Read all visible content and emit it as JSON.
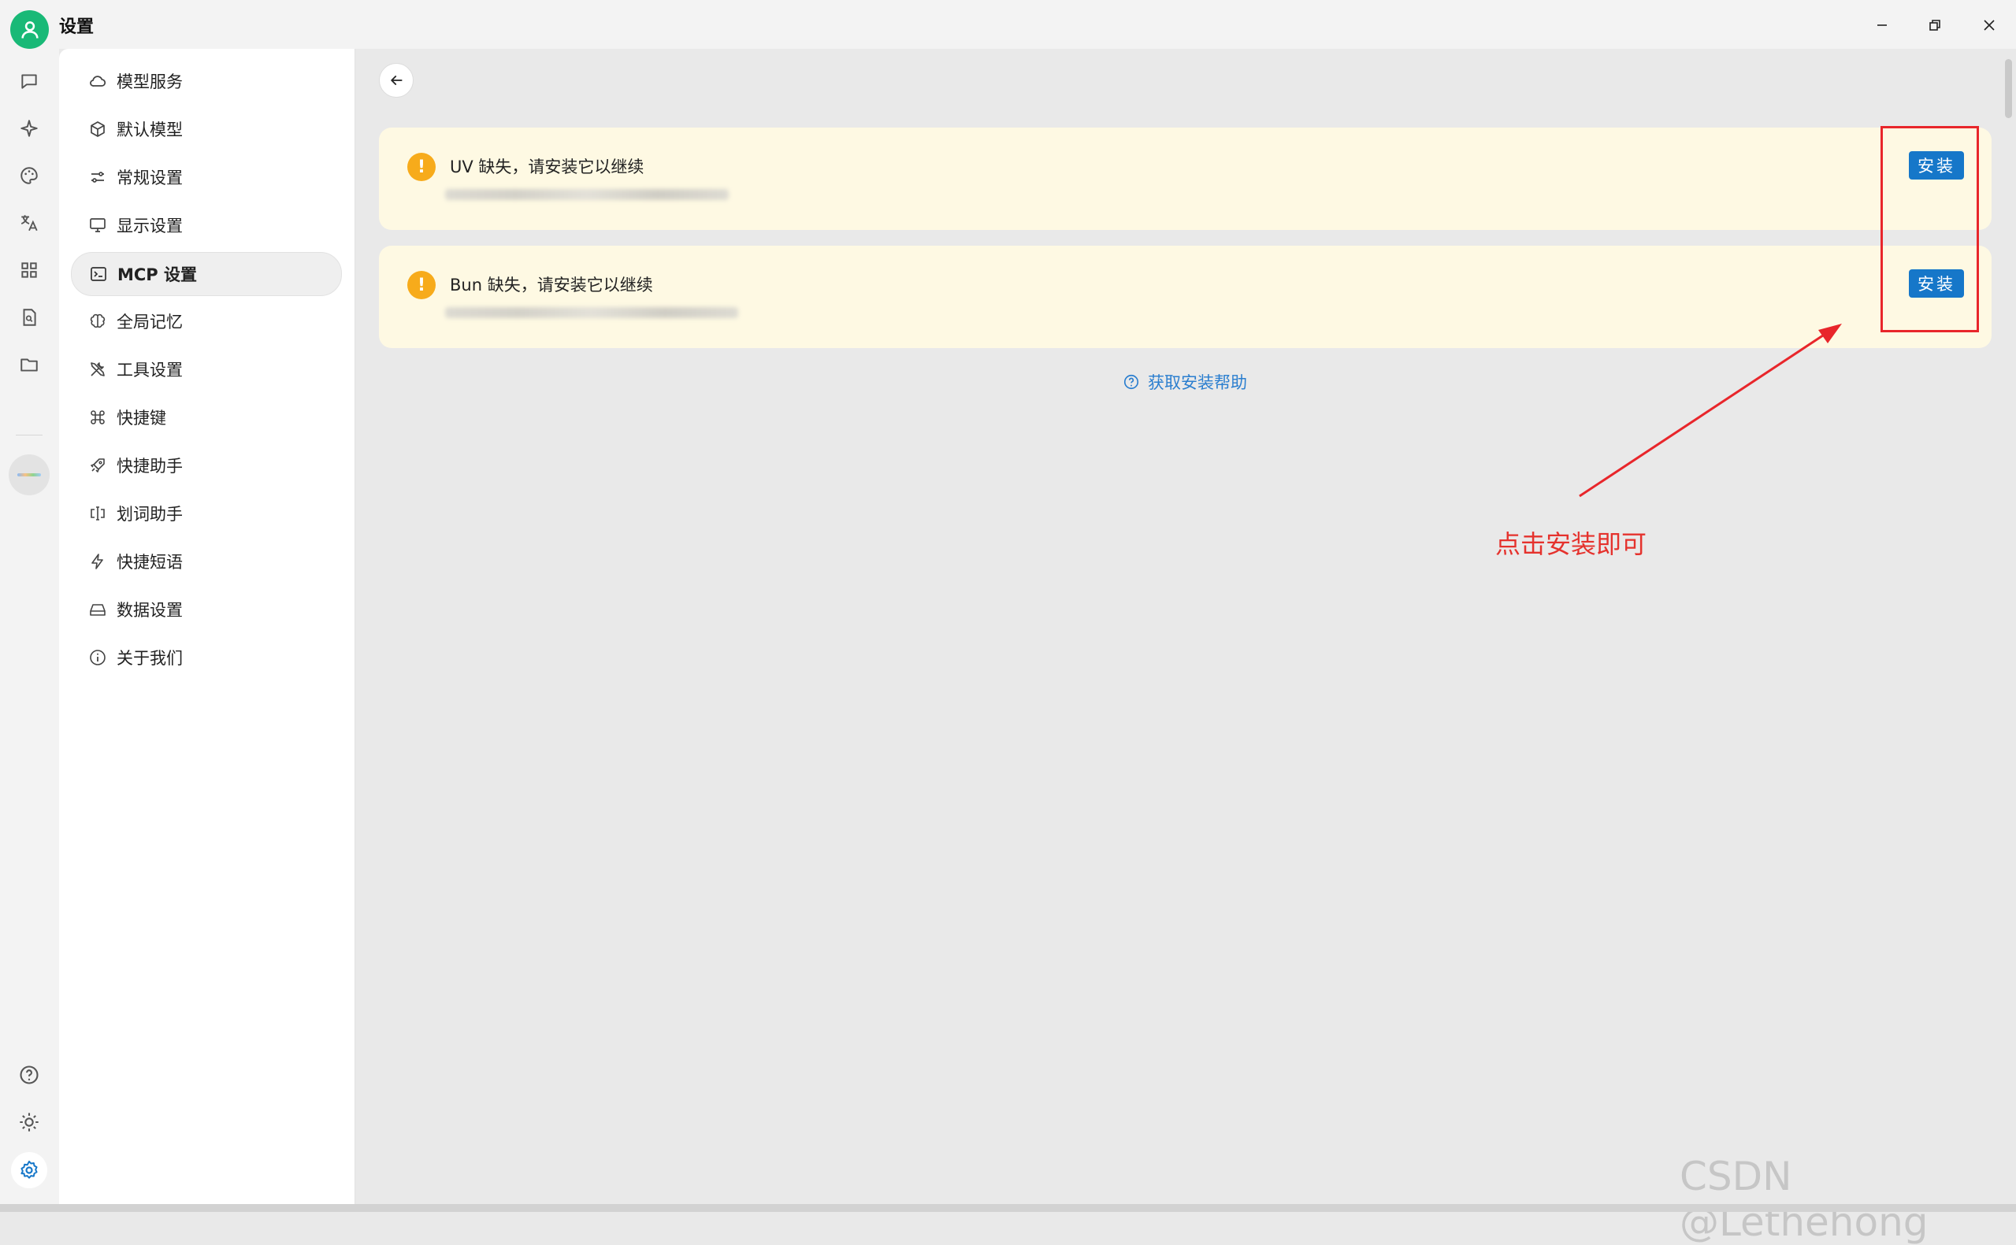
{
  "window": {
    "title": "设置"
  },
  "nav": {
    "items": [
      {
        "label": "模型服务",
        "icon": "cloud-icon"
      },
      {
        "label": "默认模型",
        "icon": "cube-icon"
      },
      {
        "label": "常规设置",
        "icon": "sliders-icon"
      },
      {
        "label": "显示设置",
        "icon": "monitor-icon"
      },
      {
        "label": "MCP 设置",
        "icon": "terminal-icon",
        "active": true
      },
      {
        "label": "全局记忆",
        "icon": "brain-icon"
      },
      {
        "label": "工具设置",
        "icon": "tools-icon"
      },
      {
        "label": "快捷键",
        "icon": "command-icon"
      },
      {
        "label": "快捷助手",
        "icon": "rocket-icon"
      },
      {
        "label": "划词助手",
        "icon": "text-cursor-icon"
      },
      {
        "label": "快捷短语",
        "icon": "lightning-icon"
      },
      {
        "label": "数据设置",
        "icon": "hard-drive-icon"
      },
      {
        "label": "关于我们",
        "icon": "info-icon"
      }
    ]
  },
  "main": {
    "cards": [
      {
        "title": "UV 缺失，请安装它以继续",
        "button": "安装"
      },
      {
        "title": "Bun 缺失，请安装它以继续",
        "button": "安装"
      }
    ],
    "help_link": "获取安装帮助"
  },
  "annotation": {
    "text": "点击安装即可",
    "color": "#e5322d"
  },
  "watermark": "CSDN @Lethehong",
  "colors": {
    "accent": "#1677c9",
    "warning": "#f7ab1b",
    "card_bg": "#fef9e3",
    "avatar": "#19b977"
  }
}
